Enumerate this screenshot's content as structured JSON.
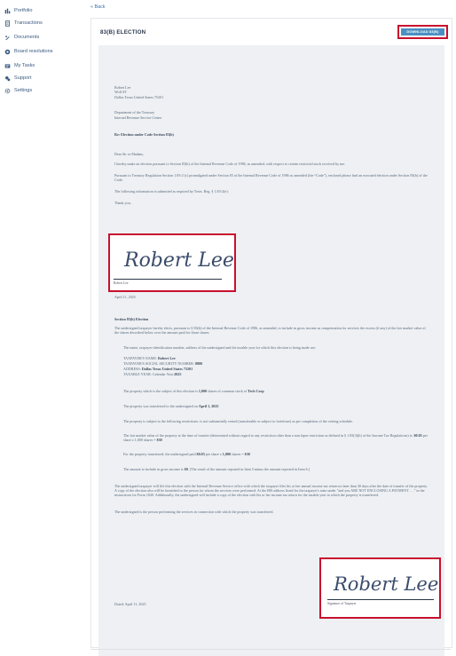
{
  "sidebar": {
    "items": [
      {
        "label": "Portfolio",
        "icon": "portfolio-icon"
      },
      {
        "label": "Transactions",
        "icon": "transactions-icon"
      },
      {
        "label": "Documents",
        "icon": "documents-icon"
      },
      {
        "label": "Board resolutions",
        "icon": "board-resolutions-icon"
      },
      {
        "label": "My Tasks",
        "icon": "tasks-icon"
      },
      {
        "label": "Support",
        "icon": "support-icon"
      },
      {
        "label": "Settings",
        "icon": "settings-icon"
      }
    ]
  },
  "header": {
    "back_label": "« Back"
  },
  "card": {
    "title": "83(B) ELECTION",
    "download_label": "DOWNLOAD 83(B)"
  },
  "document": {
    "sender_name": "Robert Lee",
    "sender_line2": "Wolf ST",
    "sender_line3": "Dallas Texas United States 75201",
    "recipient_line1": "Department of the Treasury",
    "recipient_line2": "Internal Revenue Service Center",
    "re_line": "Re: Election under Code Section 83(b)",
    "salutation": "Dear Sir or Madam,",
    "para1": "I hereby make an election pursuant to Section 83(b) of the Internal Revenue Code of 1986, as amended, with respect to certain restricted stock received by me.",
    "para2": "Pursuant to Treasury Regulation Section 1.83-2 (c) promulgated under Section 83 of the Internal Revenue Code of 1986 as amended (the “Code”), enclosed please find an executed election under Section 83(b) of the Code.",
    "para3": "The following information is submitted as required by Treas. Reg. § 1.83-2(e):",
    "closing": "Thank you,",
    "signature_script": "Robert Lee",
    "signature_caption": "Robert Lee",
    "signature_date": "April 11, 2025",
    "section_title": "Section 83(b) Election",
    "section_intro": "The undersigned taxpayer hereby elects, pursuant to § 83(b) of the Internal Revenue Code of 1986, as amended, to include in gross income as compensation for services the excess (if any) of the fair market value of the shares described below over the amount paid for those shares.",
    "item1": "The name, taxpayer identification number, address of the undersigned and the taxable year for which this election is being made are:",
    "taxpayer_name_label": "TAXPAYER'S NAME:",
    "taxpayer_name": "Robert Lee",
    "ssn_label": "TAXPAYER'S SOCIAL SECURITY NUMBER:",
    "ssn": "8800",
    "address_label": "ADDRESS:",
    "address": "Dallas Texas United States 75201",
    "taxable_year_label": "TAXABLE YEAR: Calendar Year",
    "taxable_year": "2025",
    "item2_pre": "The property which is the subject of this election is",
    "item2_shares": "1,000",
    "item2_mid": "shares of common stock of",
    "item2_company": "Tech Corp",
    "item3_pre": "The property was transferred to the undersigned on",
    "item3_date": "April 1, 2025",
    "item4": "The property is subject to the following restrictions: is not substantially vested (transferable or subject to forfeiture) as per completion of the vesting schedule.",
    "item5_pre": "The fair market value of the property at the time of transfer (determined without regard to any restriction other than a non lapse restriction as defined in § 1.83(3)(h) of the Income Tax Regulations) is:",
    "item5_price": "$0.03",
    "item5_mid": "per share x 1,000 shares =",
    "item5_total": "$30",
    "item6_pre": "For the property transferred, the undersigned paid",
    "item6_price": "$0.03",
    "item6_mid": "per share x",
    "item6_shares": "1,000",
    "item6_post": "shares =",
    "item6_total": "$30",
    "item7_pre": "The amount to include in gross income is",
    "item7_amount": "$0",
    "item7_post": ". [The result of the amount reported in Item 5 minus the amount reported in Item 6.]",
    "closing_para1": "The undersigned taxpayer will file this election with the Internal Revenue Service office with which the taxpayer files his or her annual income tax return no later than 30 days after the date of transfer of the property. A copy of the election also will be furnished to the person for whom the services were performed. At the IRS address listed for the taxpayer's state under \"and you ARE NOT ENCLOSING A PAYMENT . . .\" in the instructions for Form 1040. Additionally, the undersigned will include a copy of the election with his or her income tax return for the taxable year in which the property is transferred.",
    "closing_para2": "The undersigned is the person performing the services in connection with which the property was transferred.",
    "dated": "Dated: April 11, 2025",
    "signature2_script": "Robert Lee",
    "signature2_caption": "Signature of Taxpayer"
  },
  "colors": {
    "accent": "#4a90c2",
    "highlight": "#c8102e",
    "doc_bg": "#eef0f3",
    "text": "#596a7c"
  }
}
